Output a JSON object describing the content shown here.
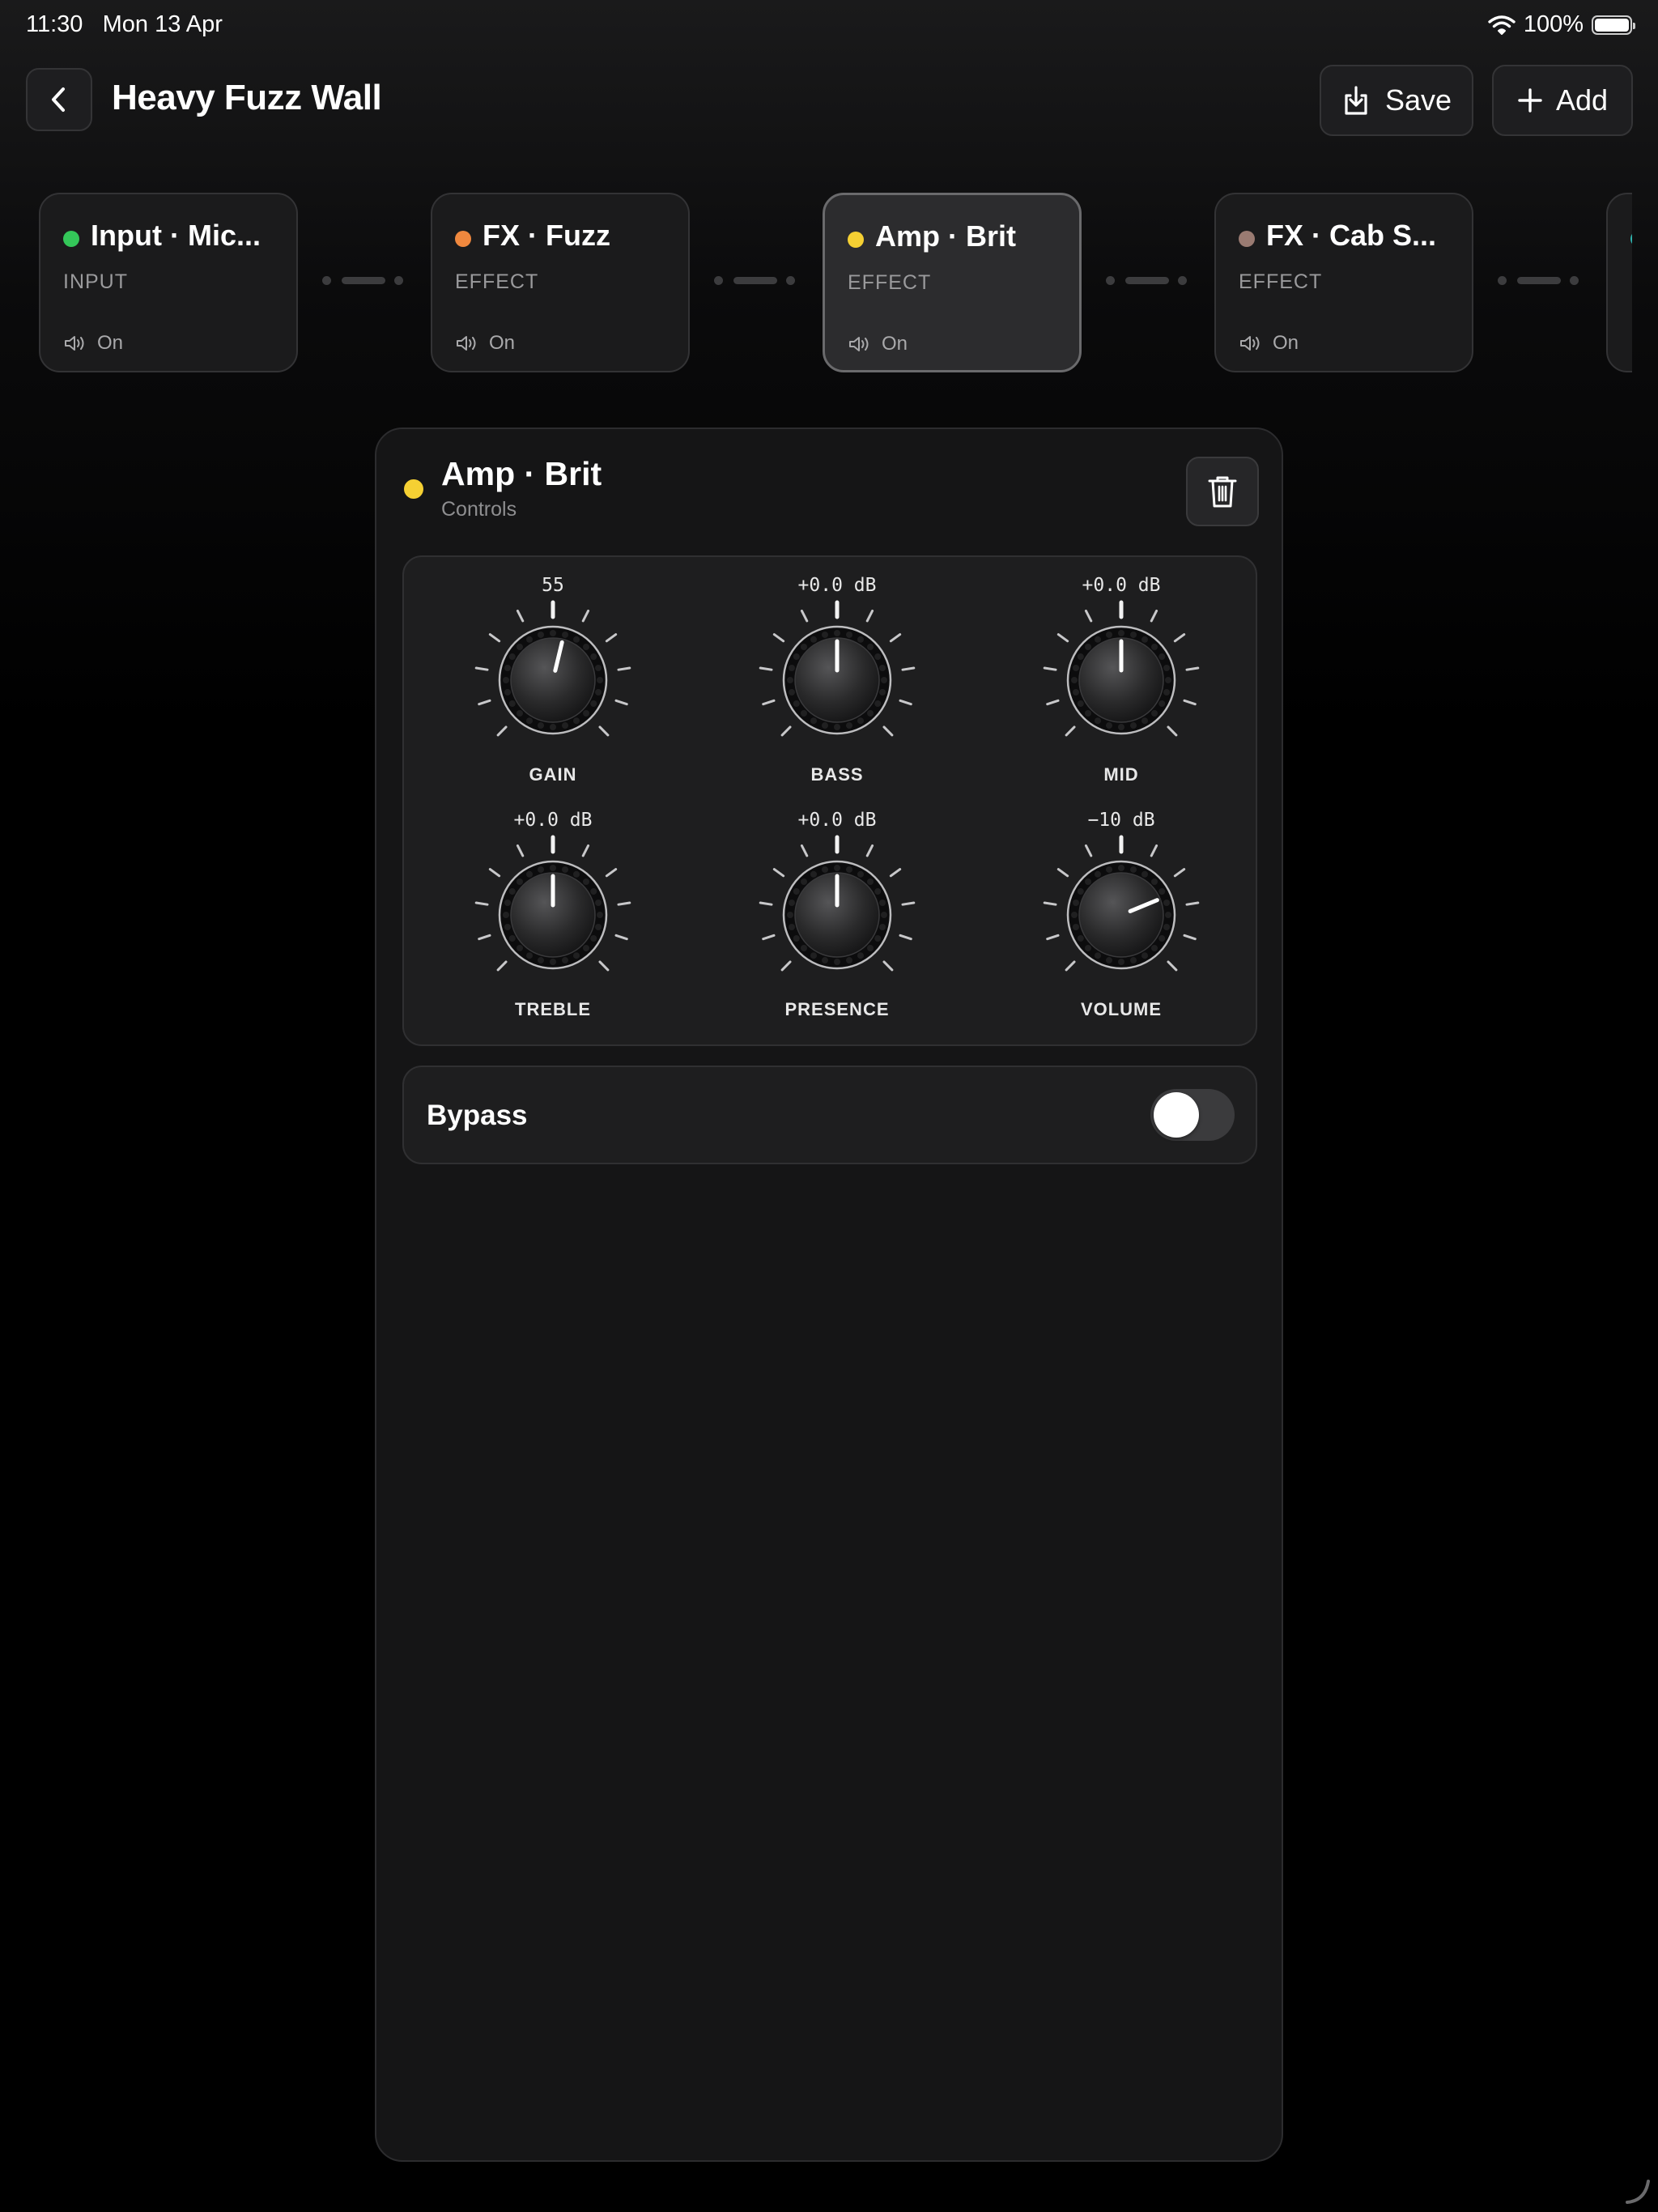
{
  "status": {
    "time": "11:30",
    "date": "Mon 13 Apr",
    "battery": "100%"
  },
  "header": {
    "title": "Heavy Fuzz Wall",
    "save_label": "Save",
    "add_label": "Add"
  },
  "chain": [
    {
      "name": "Input · Mic...",
      "kind": "INPUT",
      "state": "On",
      "color": "#34c759",
      "selected": false
    },
    {
      "name": "FX · Fuzz",
      "kind": "EFFECT",
      "state": "On",
      "color": "#f0883e",
      "selected": false
    },
    {
      "name": "Amp · Brit",
      "kind": "EFFECT",
      "state": "On",
      "color": "#f5d033",
      "selected": true
    },
    {
      "name": "FX · Cab S...",
      "kind": "EFFECT",
      "state": "On",
      "color": "#9a7b72",
      "selected": false
    }
  ],
  "panel": {
    "title": "Amp · Brit",
    "subtitle": "Controls",
    "color": "#f5d033",
    "knobs": [
      {
        "label": "GAIN",
        "value": "55",
        "level": 0.55
      },
      {
        "label": "BASS",
        "value": "+0.0 dB",
        "level": 0.5
      },
      {
        "label": "MID",
        "value": "+0.0 dB",
        "level": 0.5
      },
      {
        "label": "TREBLE",
        "value": "+0.0 dB",
        "level": 0.5
      },
      {
        "label": "PRESENCE",
        "value": "+0.0 dB",
        "level": 0.5
      },
      {
        "label": "VOLUME",
        "value": "−10 dB",
        "level": 0.75
      }
    ],
    "bypass": {
      "label": "Bypass",
      "on": false
    }
  }
}
